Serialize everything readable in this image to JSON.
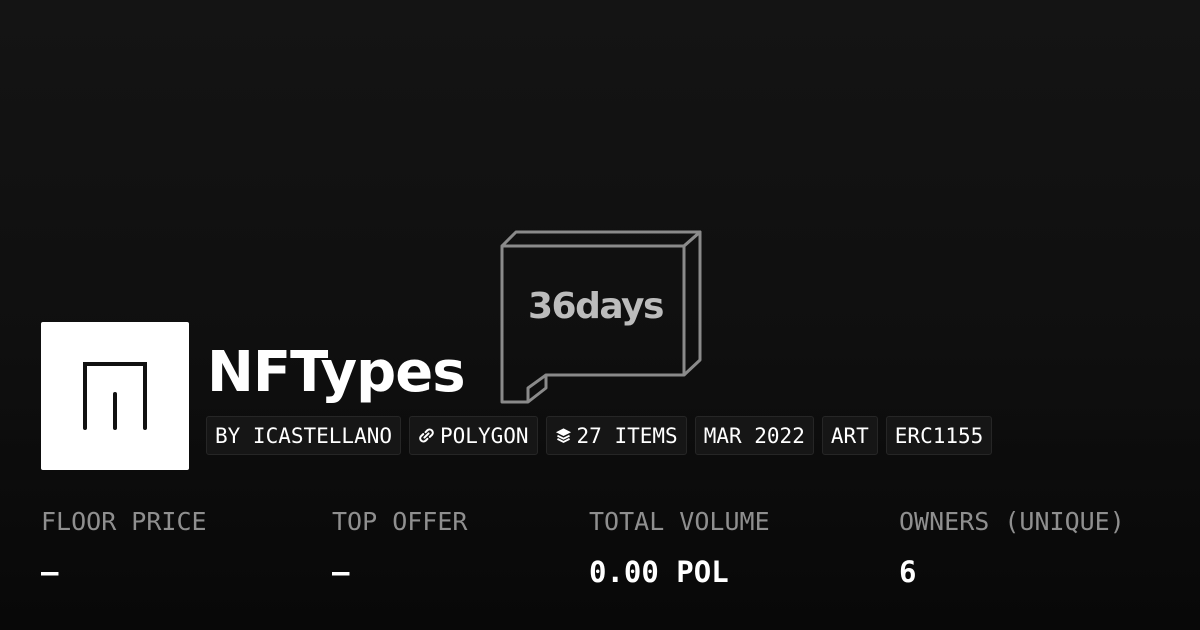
{
  "banner": {
    "text": "36days"
  },
  "collection": {
    "name": "NFTypes",
    "chips": {
      "creator": "BY ICASTELLANO",
      "chain": "POLYGON",
      "items": "27 ITEMS",
      "date": "MAR 2022",
      "category": "ART",
      "standard": "ERC1155"
    },
    "chip_icons": {
      "chain": "link-icon",
      "items": "layers-icon"
    }
  },
  "stats": [
    {
      "label": "FLOOR PRICE",
      "value": "–"
    },
    {
      "label": "TOP OFFER",
      "value": "–"
    },
    {
      "label": "TOTAL VOLUME",
      "value": "0.00 POL"
    },
    {
      "label": "OWNERS (UNIQUE)",
      "value": "6"
    }
  ],
  "colors": {
    "background": "#0f0f0f",
    "chip_background": "#161616",
    "label_gray": "#8f8f8f",
    "text": "#ffffff"
  }
}
